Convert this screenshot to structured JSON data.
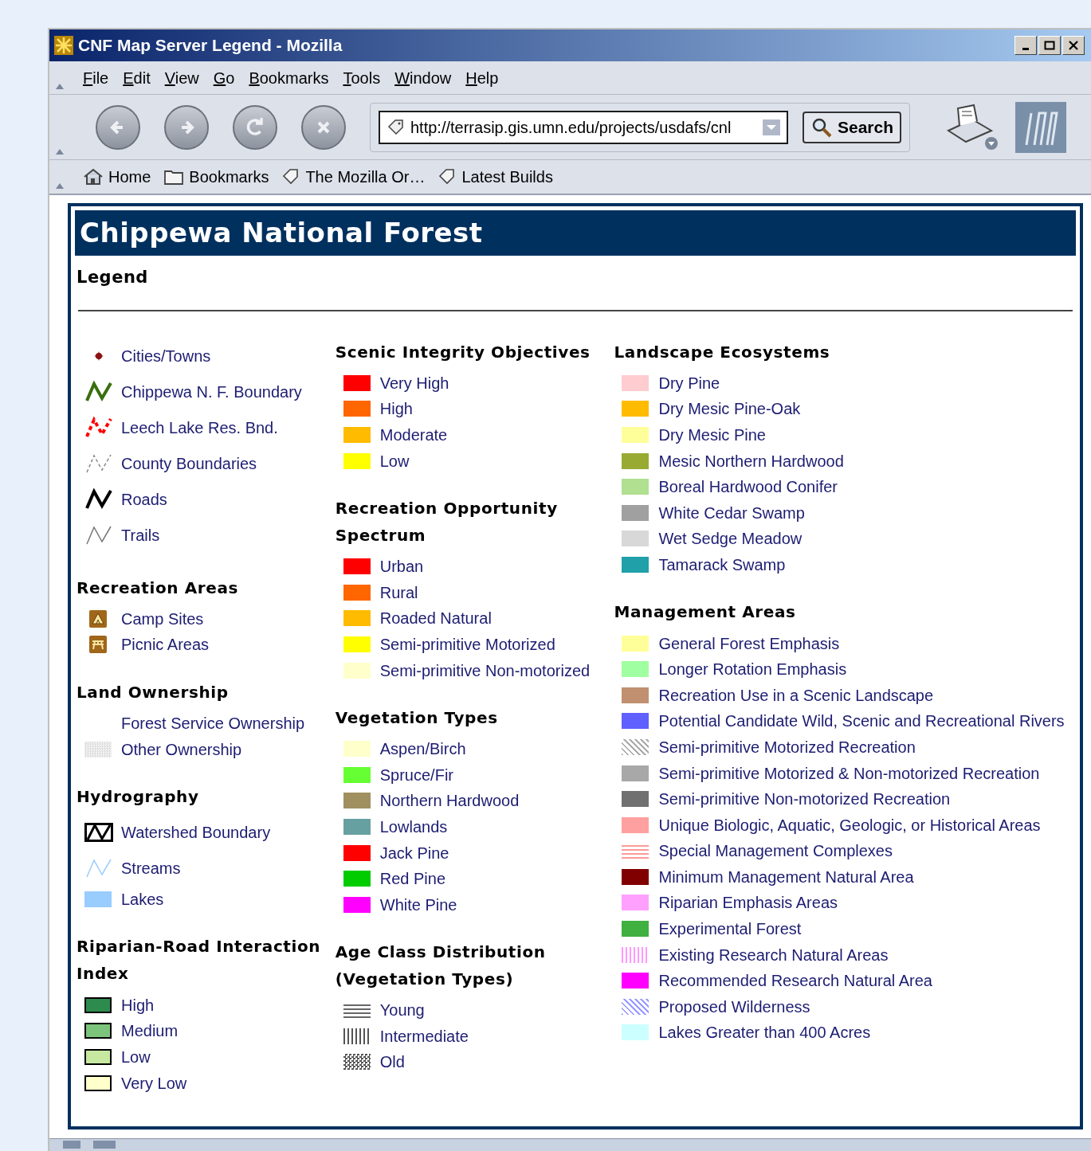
{
  "window": {
    "title": "CNF Map Server Legend - Mozilla"
  },
  "menu": [
    "File",
    "Edit",
    "View",
    "Go",
    "Bookmarks",
    "Tools",
    "Window",
    "Help"
  ],
  "address": {
    "value": "http://terrasip.gis.umn.edu/projects/usdafs/cnl"
  },
  "search_button": "Search",
  "personal_toolbar": [
    {
      "label": "Home",
      "kind": "home"
    },
    {
      "label": "Bookmarks",
      "kind": "folder"
    },
    {
      "label": "The Mozilla Or…",
      "kind": "bookmark"
    },
    {
      "label": "Latest Builds",
      "kind": "bookmark"
    }
  ],
  "page": {
    "title": "Chippewa National Forest",
    "subtitle": "Legend",
    "columns": [
      [
        {
          "items": [
            {
              "label": "Cities/Towns",
              "kind": "dot",
              "color": "#8b1010"
            },
            {
              "label": "Chippewa N. F. Boundary",
              "kind": "line",
              "color": "#3a6e10"
            },
            {
              "label": "Leech Lake Res. Bnd.",
              "kind": "dashed-line",
              "color": "#ff0000"
            },
            {
              "label": "County Boundaries",
              "kind": "thin-dashed-line",
              "color": "#888888"
            },
            {
              "label": "Roads",
              "kind": "line",
              "color": "#000000"
            },
            {
              "label": "Trails",
              "kind": "thin-line",
              "color": "#777777"
            }
          ]
        },
        {
          "heading": "Recreation Areas",
          "items": [
            {
              "label": "Camp Sites",
              "kind": "camp",
              "color": "#a0661a"
            },
            {
              "label": "Picnic Areas",
              "kind": "picnic",
              "color": "#a0661a"
            }
          ]
        },
        {
          "heading": "Land Ownership",
          "items": [
            {
              "label": "Forest Service Ownership",
              "kind": "none"
            },
            {
              "label": "Other Ownership",
              "kind": "dotted",
              "color": "#dddddd"
            }
          ]
        },
        {
          "heading": "Hydrography",
          "items": [
            {
              "label": "Watershed Boundary",
              "kind": "watershed",
              "color": "#000000"
            },
            {
              "label": "Streams",
              "kind": "thin-line",
              "color": "#99ccff"
            },
            {
              "label": "Lakes",
              "kind": "swatch",
              "color": "#99ccff"
            }
          ]
        },
        {
          "heading": "Riparian-Road Interaction Index",
          "items": [
            {
              "label": "High",
              "kind": "outlined",
              "color": "#2e8b4e"
            },
            {
              "label": "Medium",
              "kind": "outlined",
              "color": "#7cc47c"
            },
            {
              "label": "Low",
              "kind": "outlined",
              "color": "#c6e8a0"
            },
            {
              "label": "Very Low",
              "kind": "outlined",
              "color": "#ffffcc"
            }
          ]
        }
      ],
      [
        {
          "heading": "Scenic Integrity Objectives",
          "items": [
            {
              "label": "Very High",
              "kind": "swatch",
              "color": "#ff0000"
            },
            {
              "label": "High",
              "kind": "swatch",
              "color": "#ff6600"
            },
            {
              "label": "Moderate",
              "kind": "swatch",
              "color": "#ffbb00"
            },
            {
              "label": "Low",
              "kind": "swatch",
              "color": "#ffff00"
            }
          ]
        },
        {
          "heading": "Recreation Opportunity Spectrum",
          "items": [
            {
              "label": "Urban",
              "kind": "swatch",
              "color": "#ff0000"
            },
            {
              "label": "Rural",
              "kind": "swatch",
              "color": "#ff6600"
            },
            {
              "label": "Roaded Natural",
              "kind": "swatch",
              "color": "#ffbb00"
            },
            {
              "label": "Semi-primitive Motorized",
              "kind": "swatch",
              "color": "#ffff00"
            },
            {
              "label": "Semi-primitive Non-motorized",
              "kind": "swatch",
              "color": "#ffffcc"
            }
          ]
        },
        {
          "heading": "Vegetation Types",
          "items": [
            {
              "label": "Aspen/Birch",
              "kind": "swatch",
              "color": "#ffffcc"
            },
            {
              "label": "Spruce/Fir",
              "kind": "swatch",
              "color": "#66ff33"
            },
            {
              "label": "Northern Hardwood",
              "kind": "swatch",
              "color": "#a09060"
            },
            {
              "label": "Lowlands",
              "kind": "swatch",
              "color": "#66a0a0"
            },
            {
              "label": "Jack Pine",
              "kind": "swatch",
              "color": "#ff0000"
            },
            {
              "label": "Red Pine",
              "kind": "swatch",
              "color": "#00cc00"
            },
            {
              "label": "White Pine",
              "kind": "swatch",
              "color": "#ff00ff"
            }
          ]
        },
        {
          "heading": "Age Class Distribution (Vegetation Types)",
          "items": [
            {
              "label": "Young",
              "kind": "h-stripes",
              "color": "#666666"
            },
            {
              "label": "Intermediate",
              "kind": "v-stripes",
              "color": "#555555"
            },
            {
              "label": "Old",
              "kind": "checker",
              "color": "#555555"
            }
          ]
        }
      ],
      [
        {
          "heading": "Landscape Ecosystems",
          "items": [
            {
              "label": "Dry Pine",
              "kind": "swatch",
              "color": "#ffccd0"
            },
            {
              "label": "Dry Mesic Pine-Oak",
              "kind": "swatch",
              "color": "#ffbb00"
            },
            {
              "label": "Dry Mesic Pine",
              "kind": "swatch",
              "color": "#ffff99"
            },
            {
              "label": "Mesic Northern Hardwood",
              "kind": "swatch",
              "color": "#99aa33"
            },
            {
              "label": "Boreal Hardwood Conifer",
              "kind": "swatch",
              "color": "#b0e090"
            },
            {
              "label": "White Cedar Swamp",
              "kind": "swatch",
              "color": "#a0a0a0"
            },
            {
              "label": "Wet Sedge Meadow",
              "kind": "swatch",
              "color": "#d8d8d8"
            },
            {
              "label": "Tamarack Swamp",
              "kind": "swatch",
              "color": "#20a0a8"
            }
          ]
        },
        {
          "heading": "Management Areas",
          "items": [
            {
              "label": "General Forest Emphasis",
              "kind": "swatch",
              "color": "#ffff99"
            },
            {
              "label": "Longer Rotation Emphasis",
              "kind": "swatch",
              "color": "#a0ffa0"
            },
            {
              "label": "Recreation Use in a Scenic Landscape",
              "kind": "swatch",
              "color": "#c09070"
            },
            {
              "label": "Potential Candidate Wild, Scenic and Recreational Rivers",
              "kind": "swatch",
              "color": "#6060ff"
            },
            {
              "label": "Semi-primitive Motorized Recreation",
              "kind": "hatch",
              "color": "#aaaaaa"
            },
            {
              "label": "Semi-primitive Motorized & Non-motorized Recreation",
              "kind": "swatch",
              "color": "#a8a8a8"
            },
            {
              "label": "Semi-primitive Non-motorized Recreation",
              "kind": "swatch",
              "color": "#707070"
            },
            {
              "label": "Unique Biologic, Aquatic, Geologic, or Historical Areas",
              "kind": "swatch",
              "color": "#ffa0a0"
            },
            {
              "label": "Special Management Complexes",
              "kind": "h-stripes",
              "color": "#ff9999"
            },
            {
              "label": "Minimum Management Natural Area",
              "kind": "swatch",
              "color": "#800000"
            },
            {
              "label": "Riparian Emphasis Areas",
              "kind": "swatch",
              "color": "#ffa0ff"
            },
            {
              "label": "Experimental Forest",
              "kind": "swatch",
              "color": "#40b040"
            },
            {
              "label": "Existing Research Natural Areas",
              "kind": "v-stripes",
              "color": "#ff99ff"
            },
            {
              "label": "Recommended Research Natural Area",
              "kind": "swatch",
              "color": "#ff00ff"
            },
            {
              "label": "Proposed Wilderness",
              "kind": "hatch",
              "color": "#9999ff"
            },
            {
              "label": "Lakes Greater than 400 Acres",
              "kind": "swatch",
              "color": "#ccffff"
            }
          ]
        }
      ]
    ]
  }
}
